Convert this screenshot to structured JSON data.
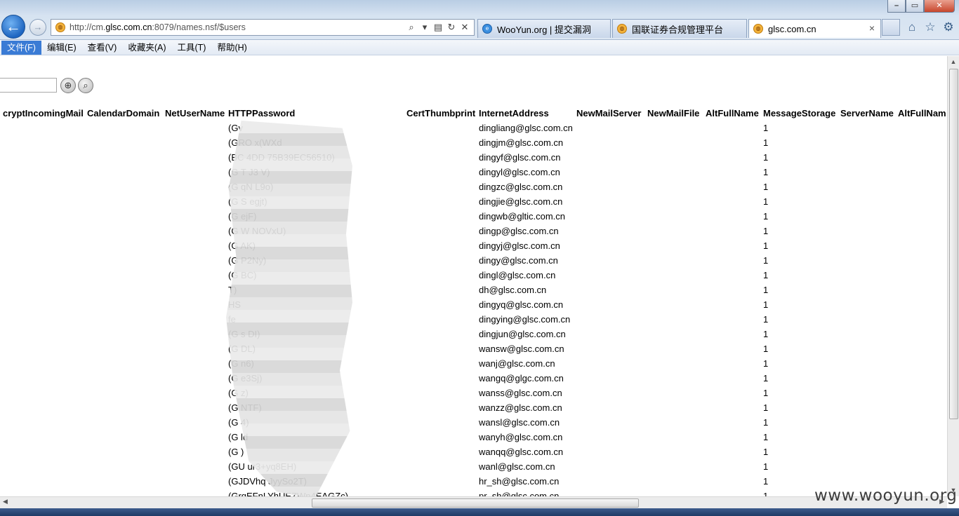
{
  "browser": {
    "url_prefix": "http://cm.",
    "url_host": "glsc.com.cn",
    "url_suffix": ":8079/names.nsf/$users",
    "tabs": [
      {
        "title": "WooYun.org | 提交漏洞",
        "icon": "ie-icon"
      },
      {
        "title": "国联证券合规管理平台",
        "icon": "site-icon"
      },
      {
        "title": "glsc.com.cn",
        "icon": "site-icon",
        "active": true
      }
    ],
    "close_glyph": "×"
  },
  "menu": [
    "文件(F)",
    "编辑(E)",
    "查看(V)",
    "收藏夹(A)",
    "工具(T)",
    "帮助(H)"
  ],
  "columns": [
    "cryptIncomingMail",
    "CalendarDomain",
    "NetUserName",
    "HTTPPassword",
    "CertThumbprint",
    "InternetAddress",
    "NewMailServer",
    "NewMailFile",
    "AltFullName",
    "MessageStorage",
    "ServerName",
    "AltFullNam"
  ],
  "rows": [
    {
      "password": "(Gv",
      "email": "dingliang@glsc.com.cn",
      "storage": "1"
    },
    {
      "password": "(GRO  x(WXd",
      "email": "dingjm@glsc.com.cn",
      "storage": "1"
    },
    {
      "password": "(BC        4DD          75B39EC56510)",
      "email": "dingyf@glsc.com.cn",
      "storage": "1"
    },
    {
      "password": "(G    T    J3          V)",
      "email": "dingyl@glsc.com.cn",
      "storage": "1"
    },
    {
      "password": "(G    qN               L9o)",
      "email": "dingzc@glsc.com.cn",
      "storage": "1"
    },
    {
      "password": "(G    S                egjt)",
      "email": "dingjie@glsc.com.cn",
      "storage": "1"
    },
    {
      "password": "(G                     ejF)",
      "email": "dingwb@gltic.com.cn",
      "storage": "1"
    },
    {
      "password": "(G                W    NOVxU)",
      "email": "dingp@glsc.com.cn",
      "storage": "1"
    },
    {
      "password": "(G                     AK)",
      "email": "dingyj@glsc.com.cn",
      "storage": "1"
    },
    {
      "password": "(G                     P2Ny)",
      "email": "dingy@glsc.com.cn",
      "storage": "1"
    },
    {
      "password": "(G                     BC)",
      "email": "dingl@glsc.com.cn",
      "storage": "1"
    },
    {
      "password": "                       T)",
      "email": "dh@glsc.com.cn",
      "storage": "1"
    },
    {
      "password": "                       HS",
      "email": "dingyq@glsc.com.cn",
      "storage": "1"
    },
    {
      "password": "                      fe",
      "email": "dingying@glsc.com.cn",
      "storage": "1"
    },
    {
      "password": "(G                s    DI)",
      "email": "dingjun@glsc.com.cn",
      "storage": "1"
    },
    {
      "password": "(G                     DL)",
      "email": "wansw@glsc.com.cn",
      "storage": "1"
    },
    {
      "password": "(G                     n6)",
      "email": "wanj@glsc.com.cn",
      "storage": "1"
    },
    {
      "password": "(G                     e3Sj)",
      "email": "wangq@glgc.com.cn",
      "storage": "1"
    },
    {
      "password": "(G                     z)",
      "email": "wanss@glsc.com.cn",
      "storage": "1"
    },
    {
      "password": "(G                     NTF)",
      "email": "wanzz@glsc.com.cn",
      "storage": "1"
    },
    {
      "password": "(G                     4)",
      "email": "wansl@glsc.com.cn",
      "storage": "1"
    },
    {
      "password": "(G                ld",
      "email": "wanyh@glsc.com.cn",
      "storage": "1"
    },
    {
      "password": "(G                     )",
      "email": "wanqq@glsc.com.cn",
      "storage": "1"
    },
    {
      "password": "(GU          ur3+yq8EH)",
      "email": "wanl@glsc.com.cn",
      "storage": "1"
    },
    {
      "password": "(GJDVhq        JyySo2T)",
      "email": "hr_sh@glsc.com.cn",
      "storage": "1"
    },
    {
      "password": "(GrqEFnLYhUEZWn4EAGZc)",
      "email": "pr_sh@glsc.com.cn",
      "storage": "1"
    }
  ],
  "watermark": "www.wooyun.org"
}
